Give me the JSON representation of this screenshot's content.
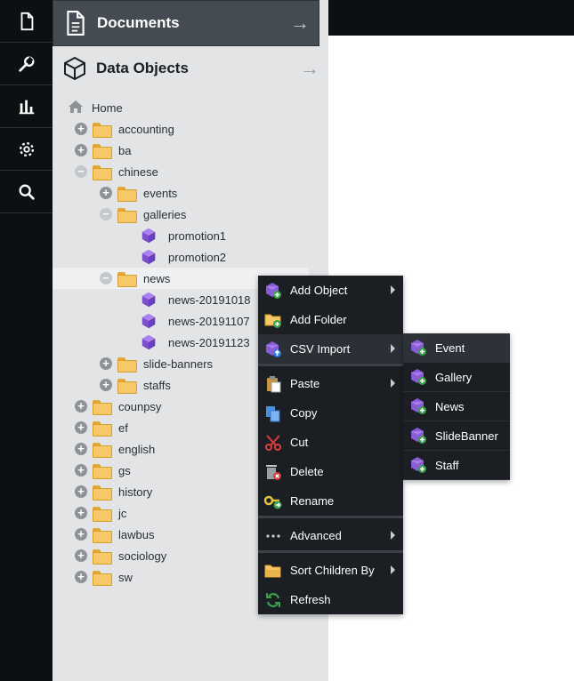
{
  "rail": {
    "icons": [
      "document-icon",
      "wrench-icon",
      "bar-chart-icon",
      "gear-icon",
      "search-icon"
    ]
  },
  "panels": {
    "documents": {
      "title": "Documents",
      "arrow": "→"
    },
    "data_objects": {
      "title": "Data Objects",
      "arrow": "→"
    }
  },
  "tree": [
    {
      "label": "Home",
      "level": 0,
      "toggle": "none",
      "icon": "home-icon"
    },
    {
      "label": "accounting",
      "level": 0,
      "toggle": "plus",
      "icon": "folder-icon"
    },
    {
      "label": "ba",
      "level": 0,
      "toggle": "plus",
      "icon": "folder-icon"
    },
    {
      "label": "chinese",
      "level": 0,
      "toggle": "minus",
      "icon": "folder-icon"
    },
    {
      "label": "events",
      "level": 1,
      "toggle": "plus",
      "icon": "folder-icon"
    },
    {
      "label": "galleries",
      "level": 1,
      "toggle": "minus",
      "icon": "folder-icon"
    },
    {
      "label": "promotion1",
      "level": 2,
      "toggle": "none",
      "icon": "object-icon"
    },
    {
      "label": "promotion2",
      "level": 2,
      "toggle": "none",
      "icon": "object-icon"
    },
    {
      "label": "news",
      "level": 1,
      "toggle": "minus",
      "icon": "folder-icon",
      "selected": true
    },
    {
      "label": "news-20191018",
      "level": 2,
      "toggle": "none",
      "icon": "object-icon"
    },
    {
      "label": "news-20191107",
      "level": 2,
      "toggle": "none",
      "icon": "object-icon"
    },
    {
      "label": "news-20191123",
      "level": 2,
      "toggle": "none",
      "icon": "object-icon"
    },
    {
      "label": "slide-banners",
      "level": 1,
      "toggle": "plus",
      "icon": "folder-icon"
    },
    {
      "label": "staffs",
      "level": 1,
      "toggle": "plus",
      "icon": "folder-icon"
    },
    {
      "label": "counpsy",
      "level": 0,
      "toggle": "plus",
      "icon": "folder-icon"
    },
    {
      "label": "ef",
      "level": 0,
      "toggle": "plus",
      "icon": "folder-icon"
    },
    {
      "label": "english",
      "level": 0,
      "toggle": "plus",
      "icon": "folder-icon"
    },
    {
      "label": "gs",
      "level": 0,
      "toggle": "plus",
      "icon": "folder-icon"
    },
    {
      "label": "history",
      "level": 0,
      "toggle": "plus",
      "icon": "folder-icon"
    },
    {
      "label": "jc",
      "level": 0,
      "toggle": "plus",
      "icon": "folder-icon"
    },
    {
      "label": "lawbus",
      "level": 0,
      "toggle": "plus",
      "icon": "folder-icon"
    },
    {
      "label": "sociology",
      "level": 0,
      "toggle": "plus",
      "icon": "folder-icon"
    },
    {
      "label": "sw",
      "level": 0,
      "toggle": "plus",
      "icon": "folder-icon"
    }
  ],
  "context_menu": {
    "add_object": "Add Object",
    "add_folder": "Add Folder",
    "csv_import": "CSV Import",
    "paste": "Paste",
    "copy": "Copy",
    "cut": "Cut",
    "delete": "Delete",
    "rename": "Rename",
    "advanced": "Advanced",
    "sort_children_by": "Sort Children By",
    "refresh": "Refresh"
  },
  "csv_submenu": {
    "items": [
      "Event",
      "Gallery",
      "News",
      "SlideBanner",
      "Staff"
    ]
  }
}
